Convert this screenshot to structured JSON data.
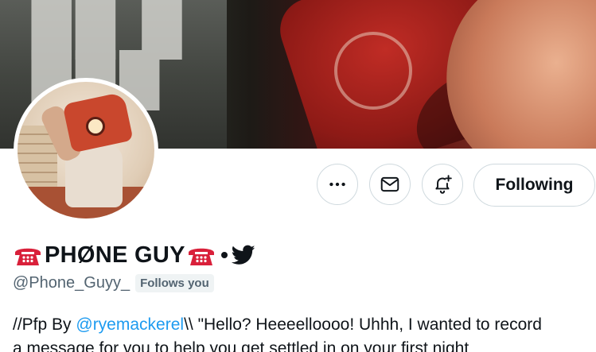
{
  "profile": {
    "display_name": "PHØNE GUY",
    "handle": "@Phone_Guyy_",
    "follows_you_badge": "Follows you",
    "name_emoji": "telephone-icon",
    "badge_icon": "twitter-bird-icon"
  },
  "actions": {
    "more_icon": "more-icon",
    "message_icon": "mail-icon",
    "notify_icon": "bell-plus-icon",
    "follow_label": "Following"
  },
  "bio": {
    "prefix": "//Pfp By ",
    "mention": "@ryemackerel",
    "line1_rest": "\\\\ \"Hello? Heeeelloooo! Uhhh, I wanted to record",
    "line2": "a message for you to help you get settled in on your first night"
  },
  "colors": {
    "accent": "#1d9bf0",
    "text": "#0f1419",
    "muted": "#536471",
    "border": "#cfd9de",
    "phone_red": "#d9203a"
  }
}
